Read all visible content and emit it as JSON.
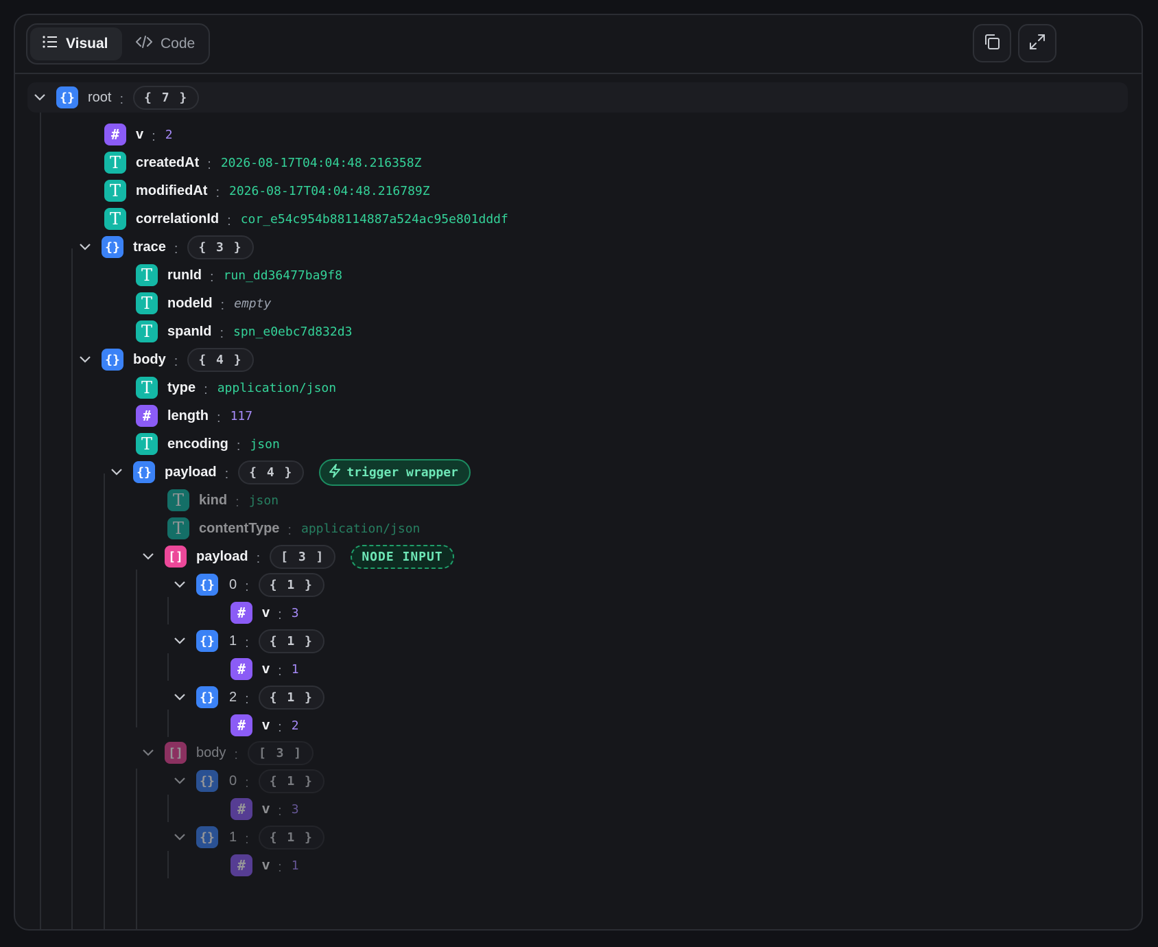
{
  "toolbar": {
    "tabs": [
      {
        "label": "Visual",
        "icon": "list-icon",
        "active": true
      },
      {
        "label": "Code",
        "icon": "code-icon",
        "active": false
      }
    ],
    "actions": [
      {
        "icon": "copy-icon"
      },
      {
        "icon": "expand-icon"
      }
    ]
  },
  "colors": {
    "object": "#3b82f6",
    "array": "#ec4899",
    "number": "#8b5cf6",
    "string": "#14b8a6",
    "string_value": "#34d399",
    "number_value": "#a78bfa"
  },
  "tree": {
    "root": {
      "key": "root",
      "count": "{ 7 }"
    },
    "v": {
      "key": "v",
      "value": "2"
    },
    "createdAt": {
      "key": "createdAt",
      "value": "2026-08-17T04:04:48.216358Z"
    },
    "modifiedAt": {
      "key": "modifiedAt",
      "value": "2026-08-17T04:04:48.216789Z"
    },
    "correlationId": {
      "key": "correlationId",
      "value": "cor_e54c954b88114887a524ac95e801dddf"
    },
    "trace": {
      "key": "trace",
      "count": "{ 3 }",
      "runId": {
        "key": "runId",
        "value": "run_dd36477ba9f8"
      },
      "nodeId": {
        "key": "nodeId",
        "value": "empty"
      },
      "spanId": {
        "key": "spanId",
        "value": "spn_e0ebc7d832d3"
      }
    },
    "body": {
      "key": "body",
      "count": "{ 4 }",
      "type": {
        "key": "type",
        "value": "application/json"
      },
      "length": {
        "key": "length",
        "value": "117"
      },
      "encoding": {
        "key": "encoding",
        "value": "json"
      },
      "payload": {
        "key": "payload",
        "count": "{ 4 }",
        "badge": "trigger wrapper",
        "kind": {
          "key": "kind",
          "value": "json"
        },
        "contentType": {
          "key": "contentType",
          "value": "application/json"
        },
        "payload": {
          "key": "payload",
          "count": "[ 3 ]",
          "badge": "NODE INPUT",
          "items": [
            {
              "key": "0",
              "count": "{ 1 }",
              "child_key": "v",
              "child_value": "3"
            },
            {
              "key": "1",
              "count": "{ 1 }",
              "child_key": "v",
              "child_value": "1"
            },
            {
              "key": "2",
              "count": "{ 1 }",
              "child_key": "v",
              "child_value": "2"
            }
          ]
        },
        "body": {
          "key": "body",
          "count": "[ 3 ]",
          "items": [
            {
              "key": "0",
              "count": "{ 1 }",
              "child_key": "v",
              "child_value": "3"
            },
            {
              "key": "1",
              "count": "{ 1 }",
              "child_key": "v",
              "child_value": "1"
            }
          ]
        }
      }
    }
  }
}
